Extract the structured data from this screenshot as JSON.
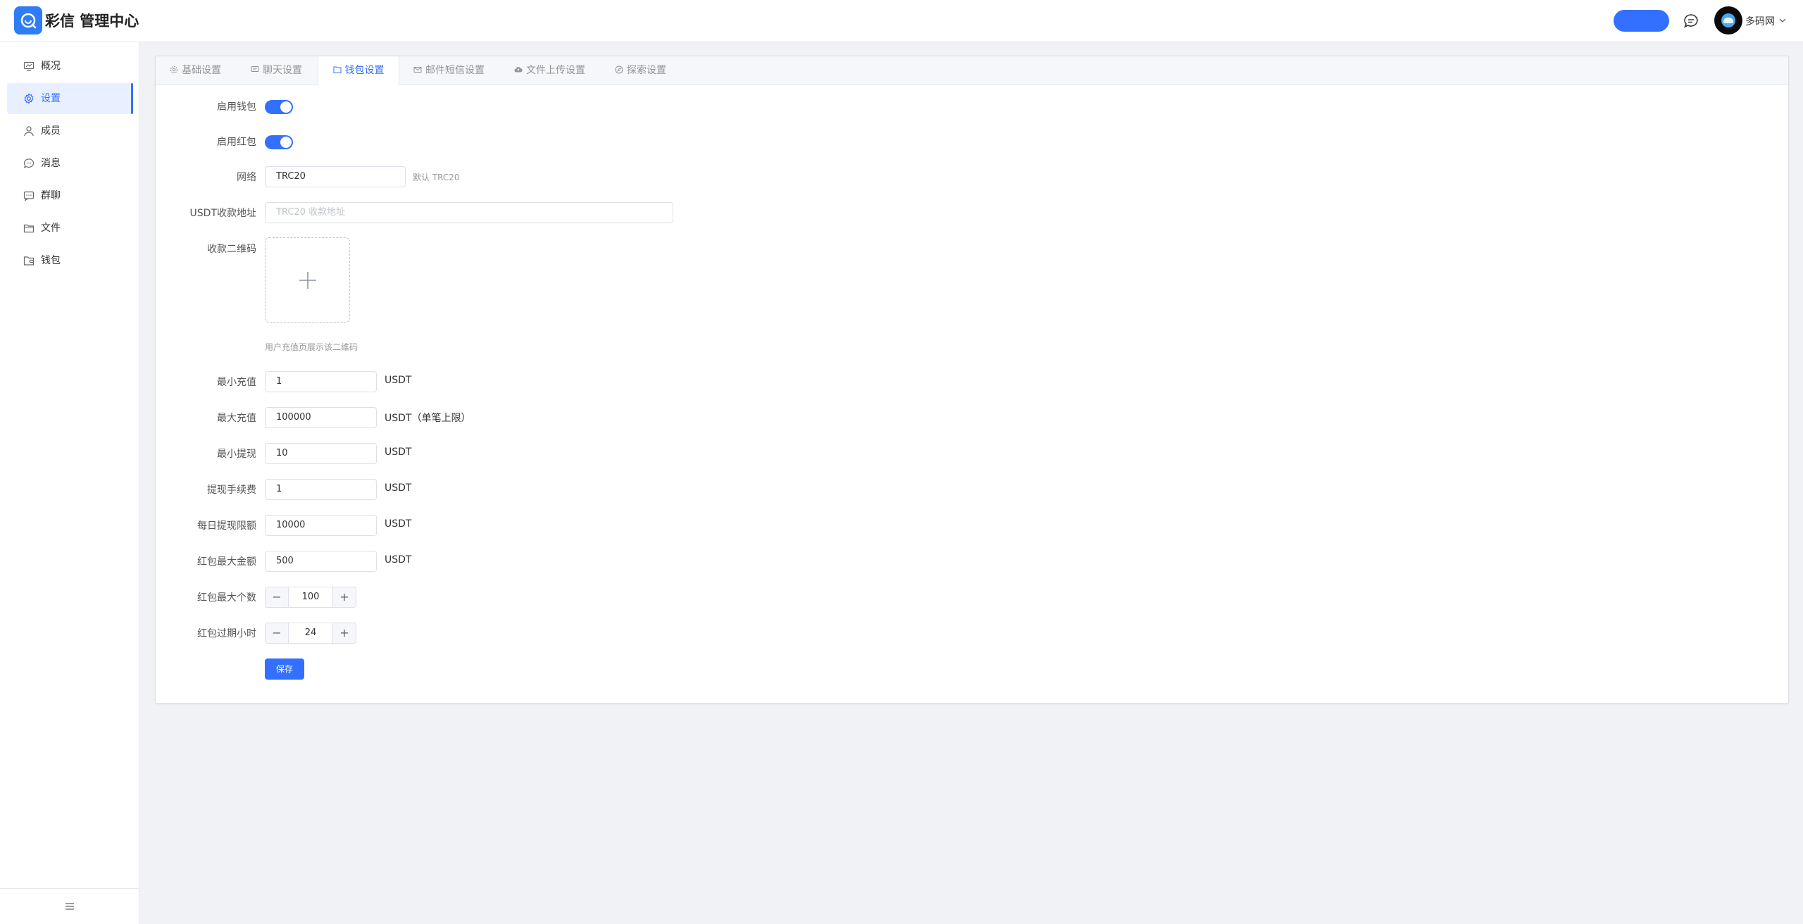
{
  "app": {
    "title": "彩信 管理中心"
  },
  "header": {
    "user_name": "多码网"
  },
  "sidebar": {
    "items": [
      {
        "label": "概况"
      },
      {
        "label": "设置"
      },
      {
        "label": "成员"
      },
      {
        "label": "消息"
      },
      {
        "label": "群聊"
      },
      {
        "label": "文件"
      },
      {
        "label": "钱包"
      }
    ],
    "active": "设置"
  },
  "tabs": [
    {
      "label": "基础设置"
    },
    {
      "label": "聊天设置"
    },
    {
      "label": "钱包设置"
    },
    {
      "label": "邮件短信设置"
    },
    {
      "label": "文件上传设置"
    },
    {
      "label": "探索设置"
    }
  ],
  "active_tab": "钱包设置",
  "form": {
    "enable_wallet": {
      "label": "启用钱包",
      "on": true
    },
    "enable_redpacket": {
      "label": "启用红包",
      "on": true
    },
    "network": {
      "label": "网络",
      "value": "TRC20",
      "hint": "默认 TRC20"
    },
    "usdt_address": {
      "label": "USDT收款地址",
      "value": "",
      "placeholder": "TRC20 收款地址"
    },
    "qr_code": {
      "label": "收款二维码",
      "hint": "用户充值页展示该二维码"
    },
    "min_recharge": {
      "label": "最小充值",
      "value": "1",
      "unit": "USDT"
    },
    "max_recharge": {
      "label": "最大充值",
      "value": "100000",
      "unit": "USDT（单笔上限）"
    },
    "min_withdraw": {
      "label": "最小提现",
      "value": "10",
      "unit": "USDT"
    },
    "withdraw_fee": {
      "label": "提现手续费",
      "value": "1",
      "unit": "USDT"
    },
    "daily_withdraw_limit": {
      "label": "每日提现限额",
      "value": "10000",
      "unit": "USDT"
    },
    "redpacket_max_amount": {
      "label": "红包最大金额",
      "value": "500",
      "unit": "USDT"
    },
    "redpacket_max_count": {
      "label": "红包最大个数",
      "value": "100",
      "minus": "−",
      "plus": "+"
    },
    "redpacket_expire_hours": {
      "label": "红包过期小时",
      "value": "24",
      "minus": "−",
      "plus": "+"
    },
    "save_label": "保存"
  },
  "colors": {
    "primary": "#3370ff",
    "background": "#f0f2f5"
  }
}
